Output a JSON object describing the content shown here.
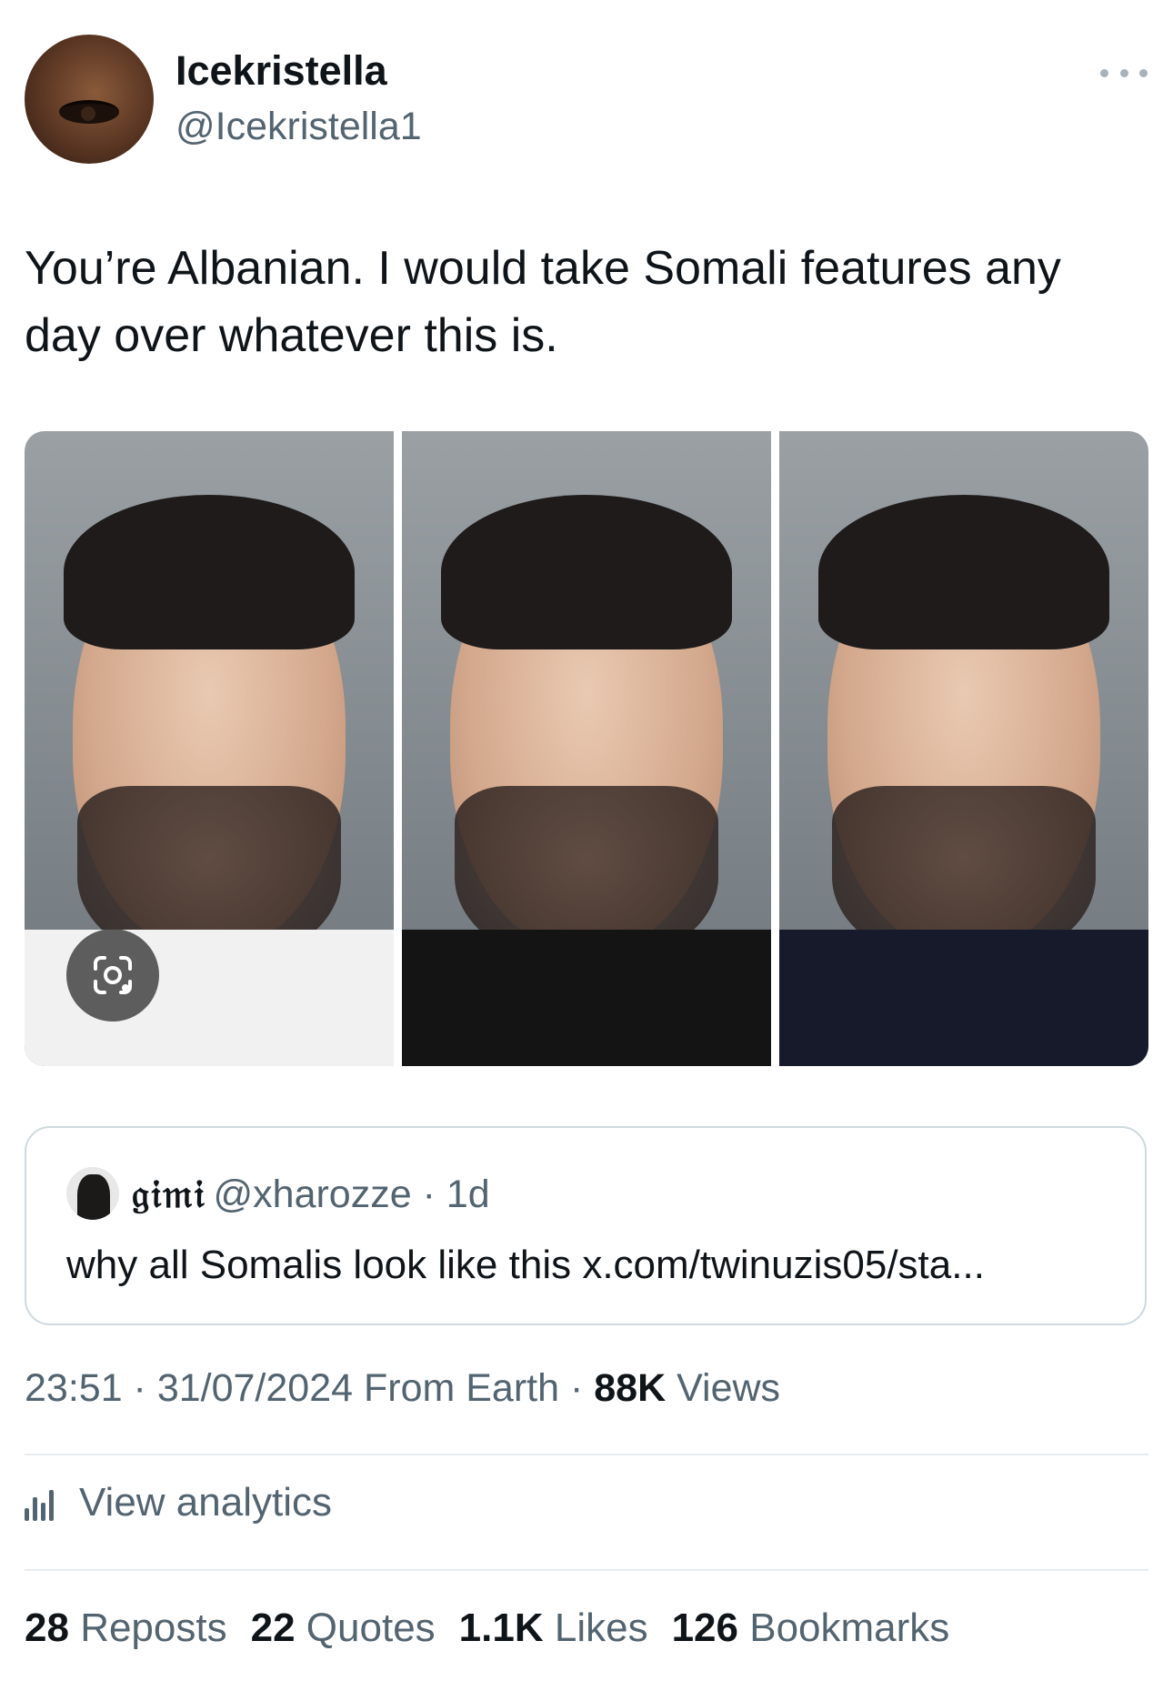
{
  "author": {
    "display_name": "Icekristella",
    "handle": "@Icekristella1"
  },
  "tweet": {
    "text": "You’re Albanian. I would take Somali features any day over whatever this is."
  },
  "media": {
    "photo_count": 3,
    "lens_icon": "camera-lens-icon"
  },
  "quoted": {
    "name": "𝔤𝔦𝔪𝔦",
    "handle_time": "@xharozze · 1d",
    "text": "why all Somalis look like this x.com/twinuzis05/sta..."
  },
  "meta": {
    "time_date": "23:51 · 31/07/2024",
    "source": "From Earth",
    "sep": "·",
    "views_count": "88K",
    "views_label": "Views"
  },
  "analytics": {
    "label": "View analytics",
    "icon": "bar-chart-icon"
  },
  "stats": {
    "reposts_count": "28",
    "reposts_label": "Reposts",
    "quotes_count": "22",
    "quotes_label": "Quotes",
    "likes_count": "1.1K",
    "likes_label": "Likes",
    "bookmarks_count": "126",
    "bookmarks_label": "Bookmarks"
  },
  "colors": {
    "text_primary": "#0f1419",
    "text_secondary": "#536471",
    "border": "#cfd9de"
  }
}
